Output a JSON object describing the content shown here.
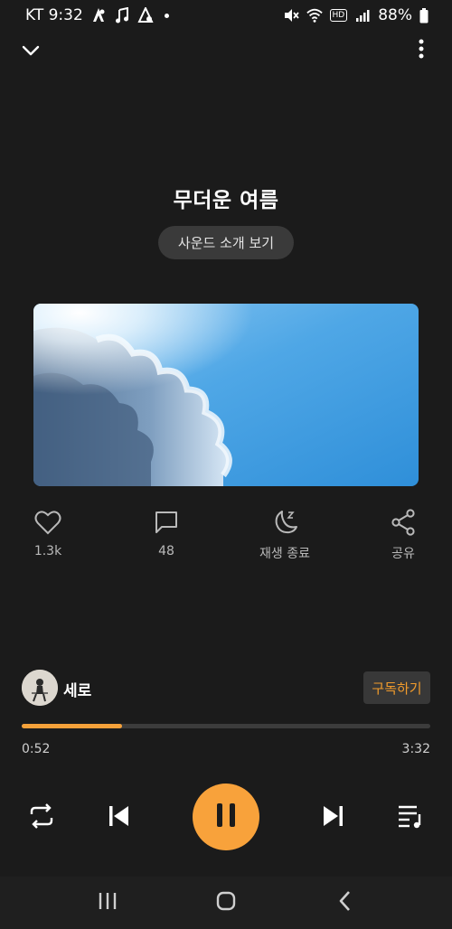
{
  "status_bar": {
    "carrier_time": "KT 9:32",
    "battery": "88%",
    "network_badge": "HD",
    "icons": [
      "app-notification-icon",
      "music-note-icon",
      "app-notification-icon",
      "mute-icon",
      "wifi-icon",
      "signal-icon",
      "battery-icon"
    ]
  },
  "header": {
    "back_icon": "chevron-down-icon",
    "more_icon": "more-vertical-icon"
  },
  "track": {
    "title": "무더운 여름",
    "intro_button_label": "사운드 소개 보기",
    "artwork_description_icon": "sky-clouds-artwork"
  },
  "actions": [
    {
      "icon": "heart-icon",
      "label": "1.3k"
    },
    {
      "icon": "comment-icon",
      "label": "48"
    },
    {
      "icon": "sleep-timer-icon",
      "label": "재생 종료"
    },
    {
      "icon": "share-icon",
      "label": "공유"
    }
  ],
  "artist": {
    "name": "세로",
    "subscribe_label": "구독하기"
  },
  "playback": {
    "current_time": "0:52",
    "total_time": "3:32",
    "progress_fraction": 0.245
  },
  "controls": {
    "repeat_icon": "repeat-icon",
    "prev_icon": "skip-previous-icon",
    "play_icon": "pause-icon",
    "next_icon": "skip-next-icon",
    "queue_icon": "playlist-icon"
  },
  "nav": {
    "recent_icon": "recent-apps-icon",
    "home_icon": "home-icon",
    "back_icon": "back-icon"
  },
  "colors": {
    "background": "#1b1b1b",
    "accent": "#f8a23b",
    "subscribe_text": "#f29c2c"
  }
}
